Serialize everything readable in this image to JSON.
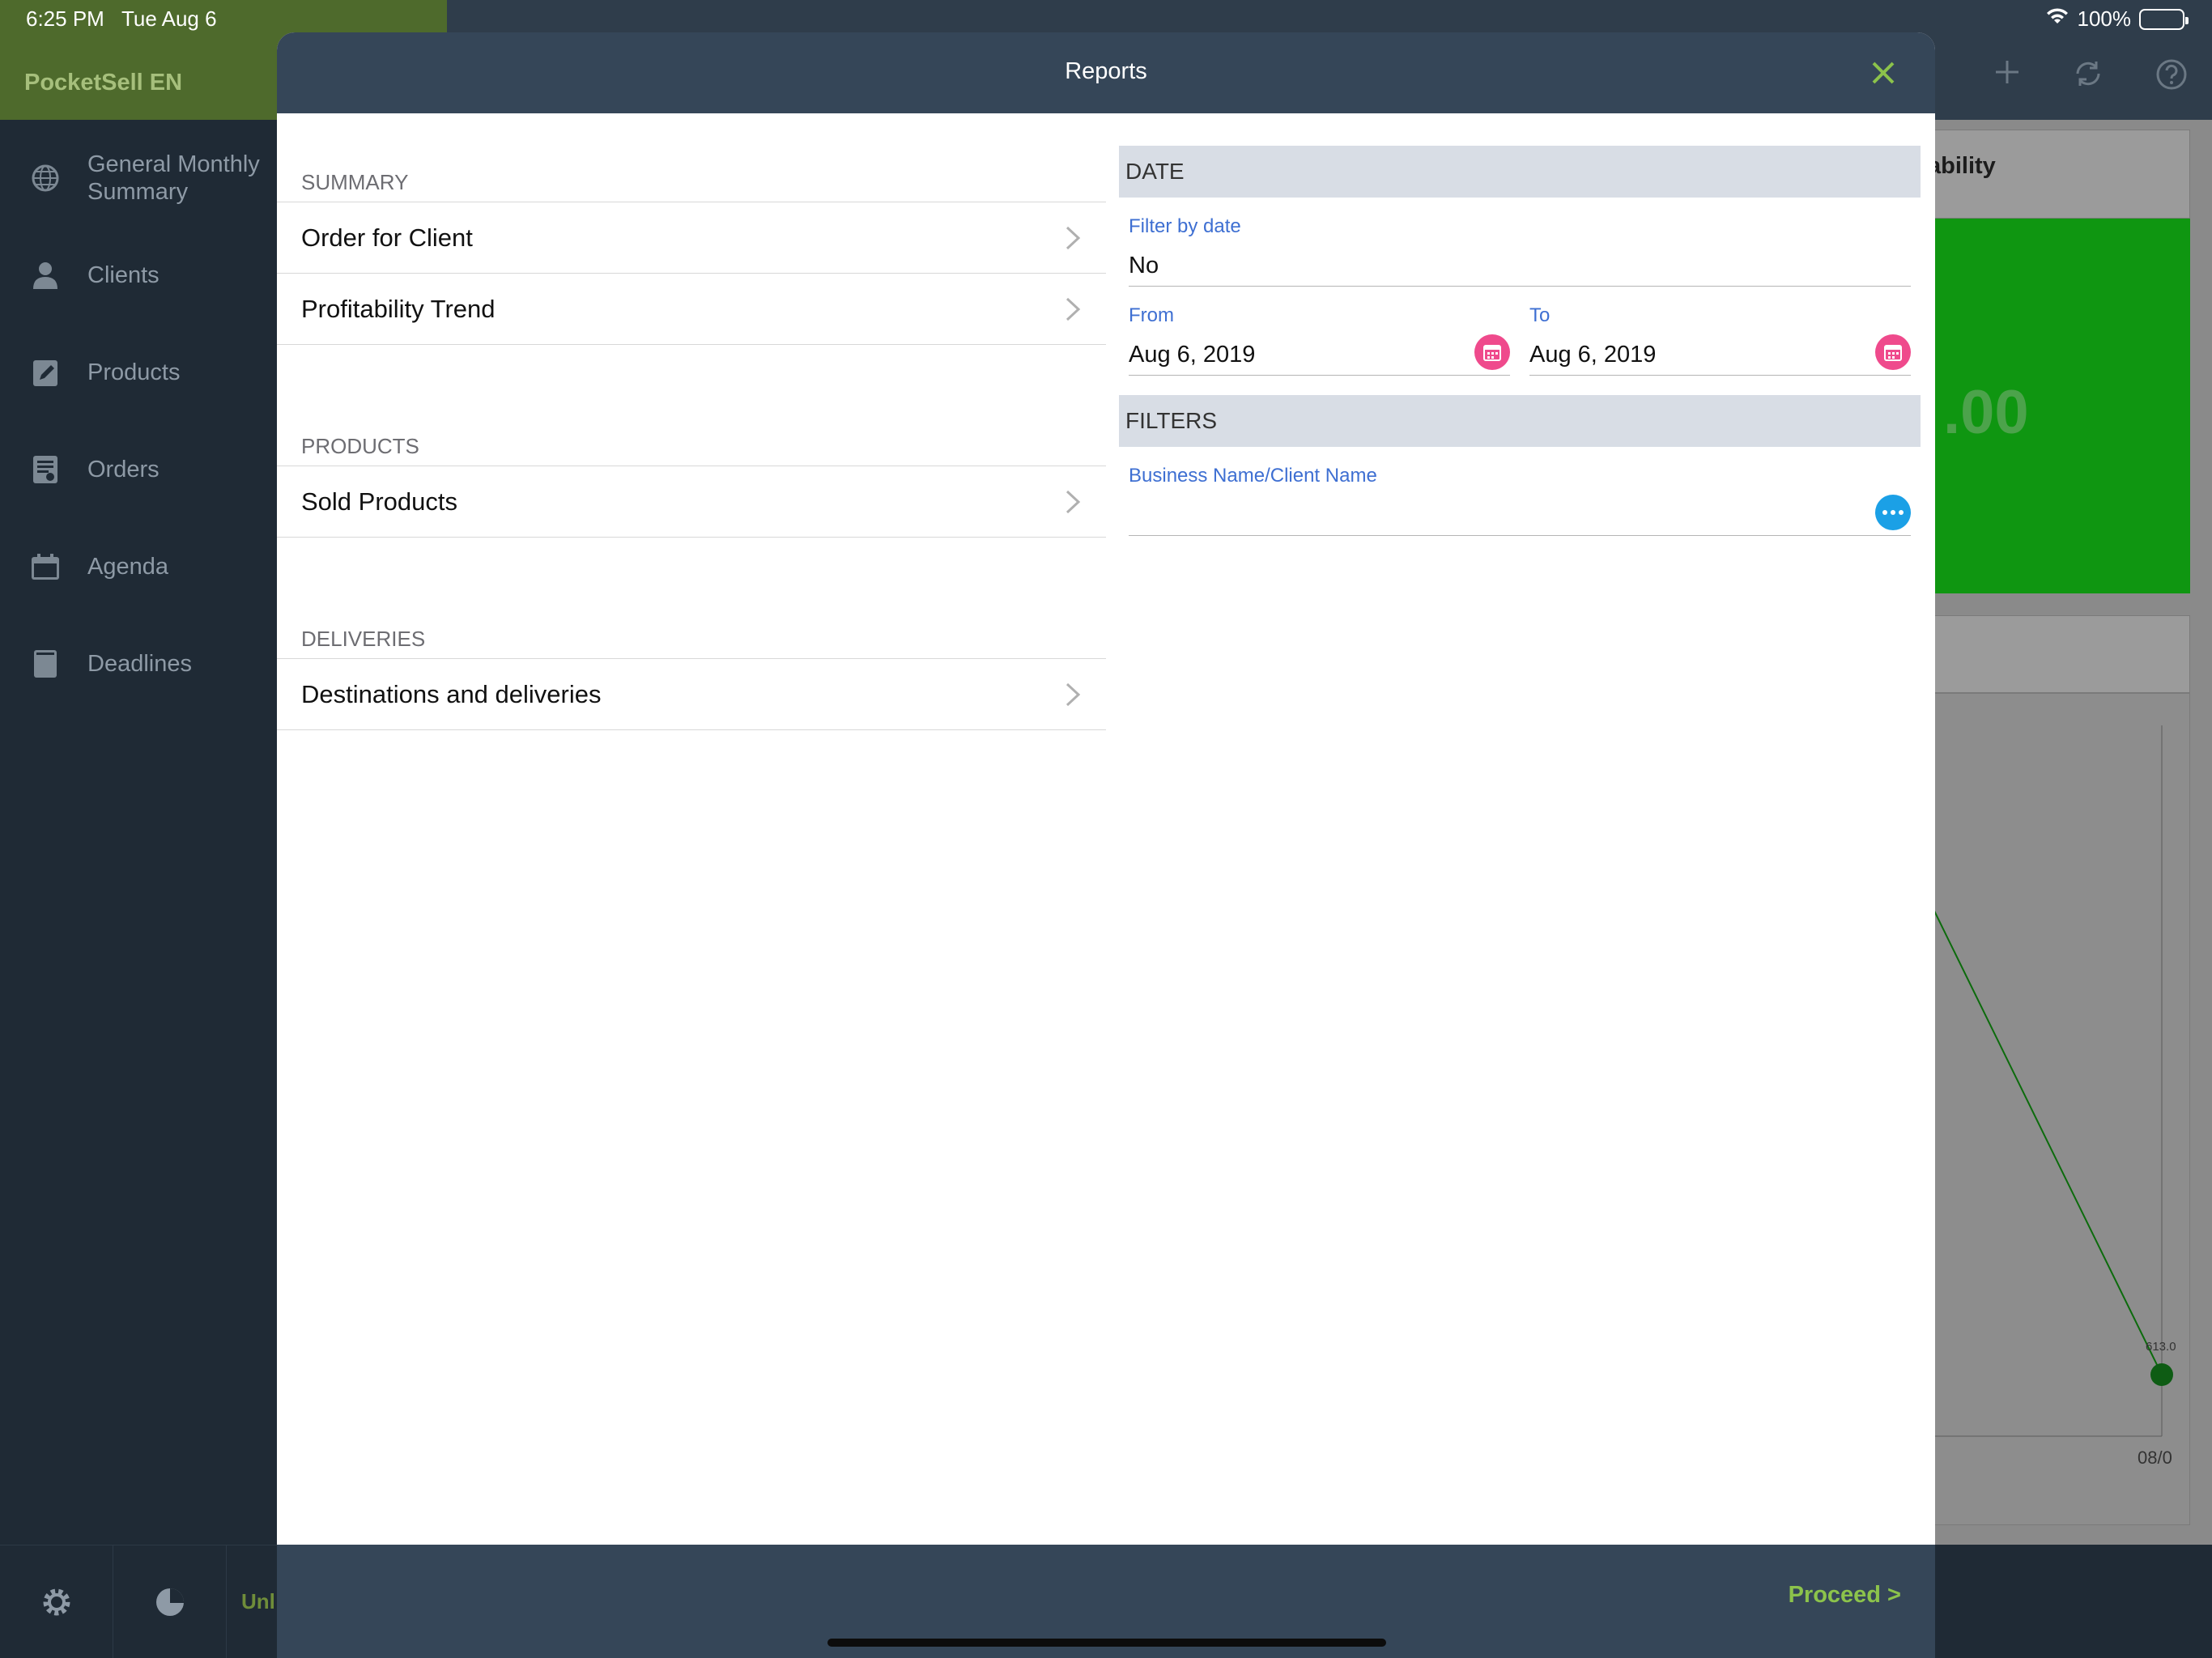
{
  "status_bar": {
    "time": "6:25 PM",
    "date": "Tue Aug 6",
    "battery": "100%"
  },
  "sidebar": {
    "app_title": "PocketSell EN",
    "items": [
      {
        "label": "General Monthly Summary",
        "icon": "globe-icon"
      },
      {
        "label": "Clients",
        "icon": "person-icon"
      },
      {
        "label": "Products",
        "icon": "edit-icon"
      },
      {
        "label": "Orders",
        "icon": "document-icon"
      },
      {
        "label": "Agenda",
        "icon": "calendar-icon"
      },
      {
        "label": "Deadlines",
        "icon": "book-icon"
      }
    ],
    "footer_unlock": "Unl"
  },
  "background": {
    "card_label": "ability",
    "card_amount": ".00",
    "chart_point_label": "613.0",
    "chart_axis_label": "08/0"
  },
  "modal": {
    "title": "Reports",
    "sections": [
      {
        "header": "SUMMARY",
        "rows": [
          "Order for Client",
          "Profitability Trend"
        ]
      },
      {
        "header": "PRODUCTS",
        "rows": [
          "Sold Products"
        ]
      },
      {
        "header": "DELIVERIES",
        "rows": [
          "Destinations and deliveries"
        ]
      }
    ],
    "date_group": {
      "header": "DATE",
      "filter_label": "Filter by date",
      "filter_value": "No",
      "from_label": "From",
      "from_value": "Aug 6, 2019",
      "to_label": "To",
      "to_value": "Aug 6, 2019"
    },
    "filters_group": {
      "header": "FILTERS",
      "client_label": "Business Name/Client Name",
      "client_value": ""
    },
    "proceed_label": "Proceed >"
  },
  "colors": {
    "modal_header": "#354658",
    "accent_green": "#8cc34b",
    "field_label_blue": "#3e6fd2",
    "calendar_pink": "#ef4a8c",
    "more_blue": "#1ba0e6"
  }
}
